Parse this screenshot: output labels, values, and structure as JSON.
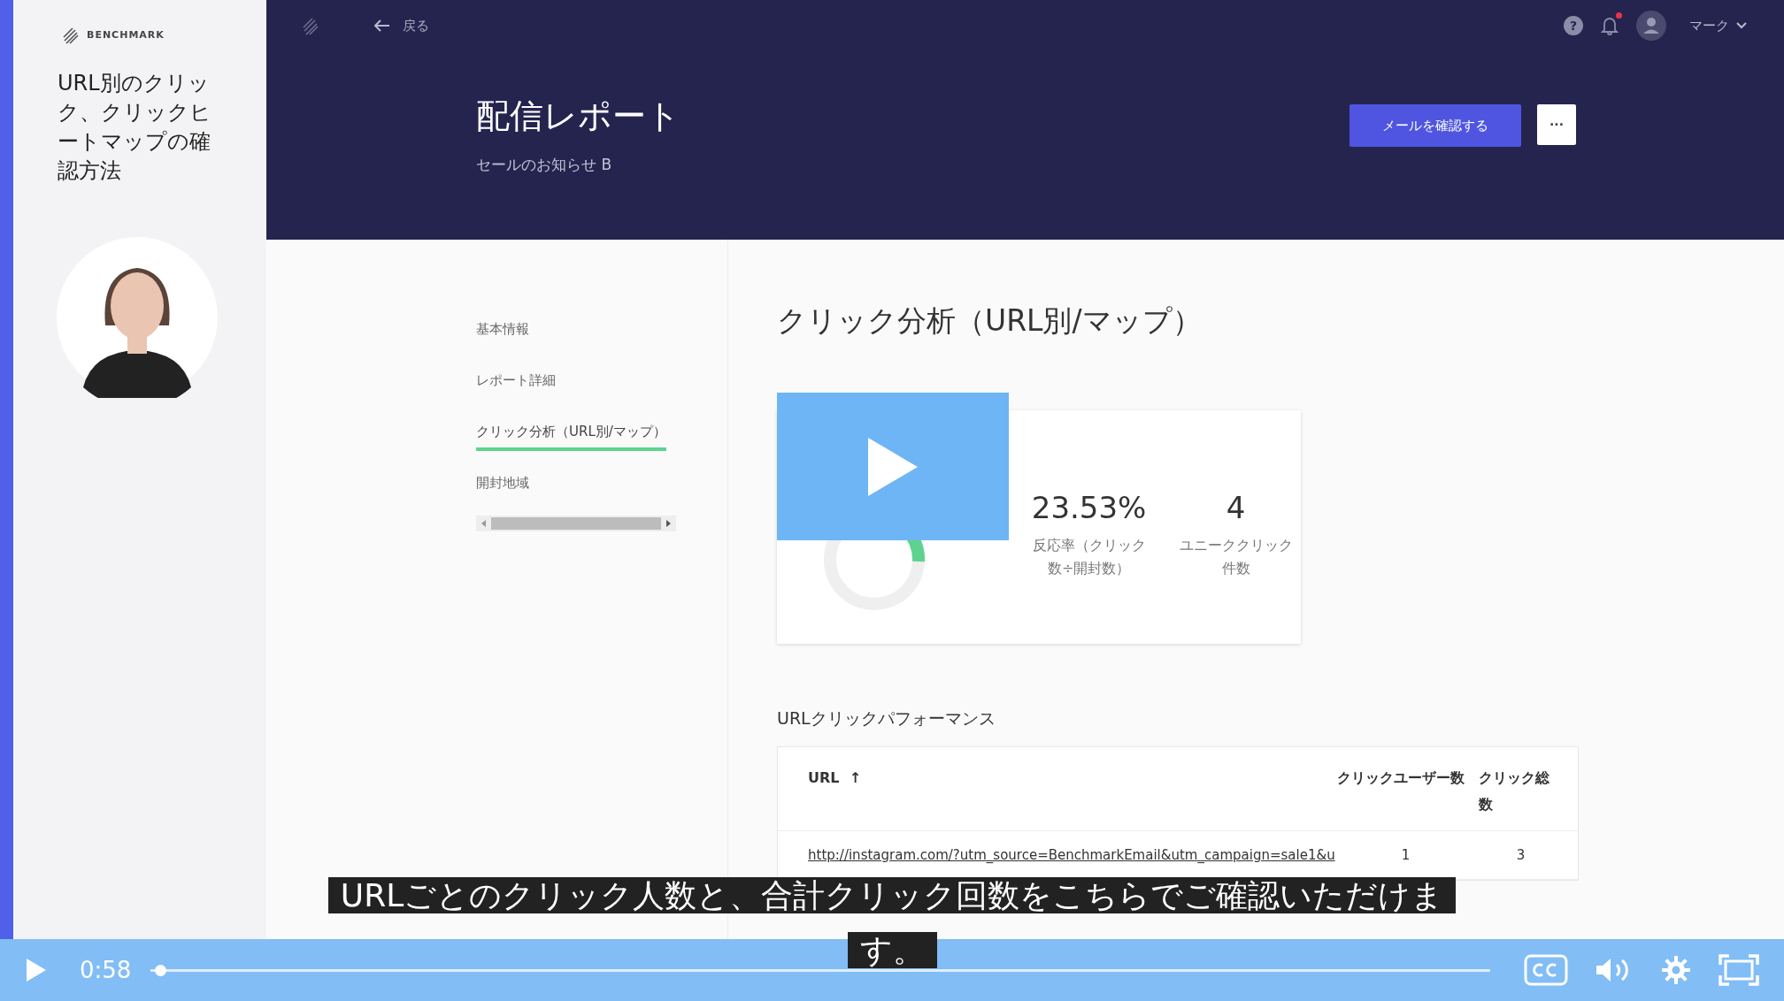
{
  "lesson": {
    "logo": "BENCHMARK",
    "title": "URL別のクリック、クリックヒートマップの確認方法"
  },
  "app_header": {
    "back": "戻る",
    "help": "?",
    "has_unread": true,
    "user": "マーク"
  },
  "page": {
    "title": "配信レポート",
    "subtitle": "セールのお知らせ B",
    "primary_button": "メールを確認する",
    "more_button": "···"
  },
  "nav": [
    {
      "label": "基本情報",
      "selected": false
    },
    {
      "label": "レポート詳細",
      "selected": false
    },
    {
      "label": "クリック分析（URL別/マップ）",
      "selected": true
    },
    {
      "label": "開封地域",
      "selected": false
    }
  ],
  "section": {
    "title": "クリック分析（URL別/マップ）",
    "stats": [
      {
        "value": "23.53%",
        "label": "反応率（クリック数÷開封数）"
      },
      {
        "value": "4",
        "label": "ユニーククリック件数"
      }
    ],
    "table_title": "URLクリックパフォーマンス",
    "columns": [
      {
        "label": "URL",
        "sort": "↑"
      },
      {
        "label": "クリックユーザー数"
      },
      {
        "label": "クリック総数"
      }
    ],
    "rows": [
      [
        "http://instagram.com/?utm_source=BenchmarkEmail&utm_campaign=sale1&u",
        "1",
        "3"
      ]
    ]
  },
  "video": {
    "paused": true,
    "time": "0:58",
    "level": 0.003,
    "caption": "URLごとのクリック人数と、合計クリック回数をこちらでご確認いただけます。"
  }
}
